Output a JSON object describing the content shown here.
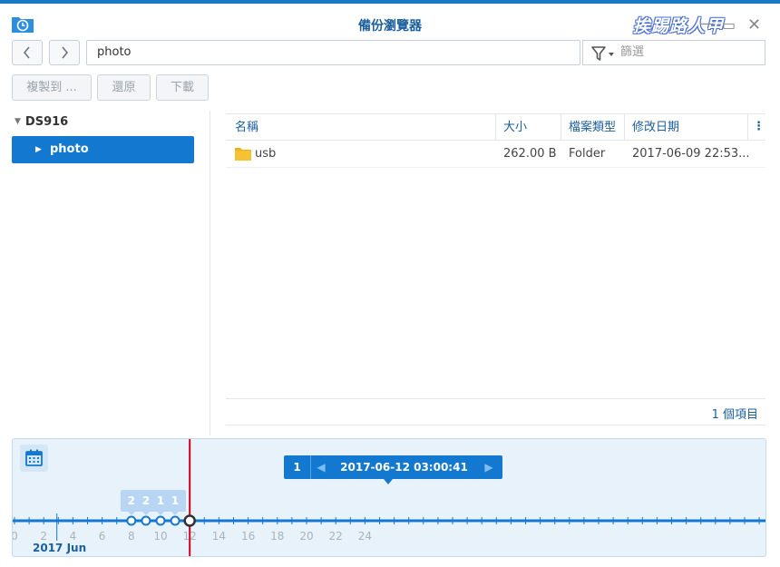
{
  "window": {
    "title": "備份瀏覽器",
    "watermark": "挨踢路人甲",
    "controls": {
      "minimize": "—",
      "maximize": "▭",
      "close": "✕"
    }
  },
  "nav": {
    "back_icon": "chevron-left-icon",
    "forward_icon": "chevron-right-icon",
    "path": "photo",
    "filter_placeholder": "篩選"
  },
  "actions": {
    "copy_label": "複製到 ...",
    "restore_label": "還原",
    "download_label": "下載"
  },
  "tree": {
    "root": "DS916",
    "items": [
      {
        "label": "photo",
        "selected": true
      }
    ]
  },
  "grid": {
    "columns": [
      "名稱",
      "大小",
      "檔案類型",
      "修改日期"
    ],
    "rows": [
      {
        "name": "usb",
        "size": "262.00 B",
        "type": "Folder",
        "modified": "2017-06-09 22:53..."
      }
    ],
    "footer": "1 個項目"
  },
  "timeline": {
    "selected_count": "1",
    "selected_datetime": "2017-06-12 03:00:41",
    "month_label": "2017 Jun",
    "tick_labels": [
      "0",
      "2",
      "4",
      "6",
      "8",
      "10",
      "12",
      "14",
      "16",
      "18",
      "20",
      "22",
      "24"
    ],
    "snapshots": [
      {
        "day": 8,
        "count": "2"
      },
      {
        "day": 9,
        "count": "2"
      },
      {
        "day": 10,
        "count": "1"
      },
      {
        "day": 11,
        "count": "1"
      },
      {
        "day": 12,
        "selected": true
      }
    ],
    "accent": "#1378d0",
    "marker_color": "#d0021b"
  }
}
